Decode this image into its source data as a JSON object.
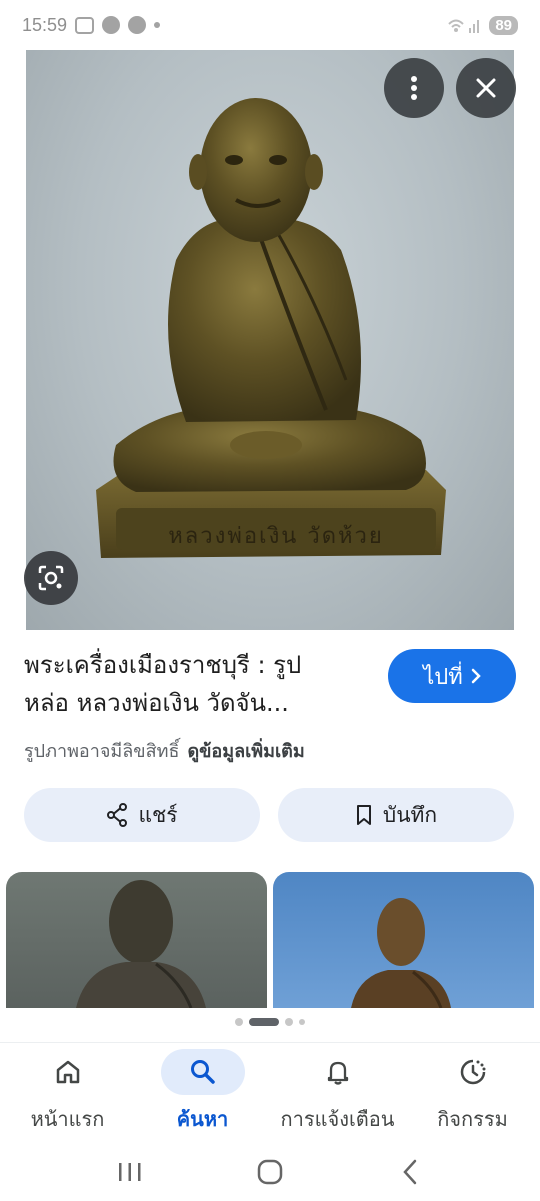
{
  "status_bar": {
    "time": "15:59",
    "battery": "89"
  },
  "image_viewer": {
    "icons": [
      "more-vert-icon",
      "close-icon",
      "lens-icon"
    ],
    "statue_inscription": "หลวงพ่อเงิน วัดห้วย"
  },
  "result": {
    "title": "พระเครื่องเมืองราชบุรี : รูปหล่อ หลวงพ่อเงิน วัดจัน...",
    "title_line1": "พระเครื่องเมืองราชบุรี : รูป",
    "title_line2": "หล่อ หลวงพ่อเงิน วัดจัน...",
    "goto_label": "ไปที่",
    "copyright_notice": "รูปภาพอาจมีลิขสิทธิ์",
    "more_info": "ดูข้อมูลเพิ่มเติม"
  },
  "actions": {
    "share_label": "แชร์",
    "save_label": "บันทึก"
  },
  "pager": {
    "total": 4,
    "active_index": 1
  },
  "bottom_nav": {
    "items": [
      {
        "label": "หน้าแรก",
        "icon": "home-icon",
        "active": false
      },
      {
        "label": "ค้นหา",
        "icon": "search-icon",
        "active": true
      },
      {
        "label": "การแจ้งเตือน",
        "icon": "bell-icon",
        "active": false
      },
      {
        "label": "กิจกรรม",
        "icon": "activity-icon",
        "active": false
      }
    ]
  },
  "colors": {
    "accent": "#1a73e8",
    "active_nav": "#0b57d0",
    "pill_bg": "#e8eef9"
  }
}
